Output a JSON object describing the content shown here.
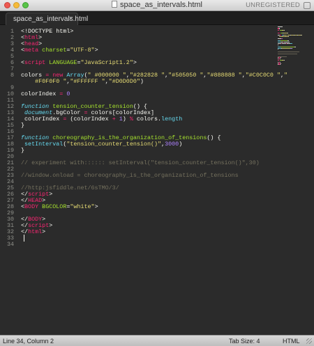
{
  "window": {
    "title": "space_as_intervals.html",
    "registration": "UNREGISTERED"
  },
  "tab": {
    "label": "space_as_intervals.html",
    "close_glyph": "×"
  },
  "theme": {
    "tag": "#f92672",
    "attr": "#a6e22e",
    "string": "#e6db74",
    "keyword": "#66d9ef",
    "number": "#ae81ff",
    "comment": "#75715e",
    "background": "#2b2b2b"
  },
  "code_lines": [
    {
      "n": "1",
      "tokens": [
        [
          "plain",
          "<!DOCTYPE html>"
        ]
      ]
    },
    {
      "n": "2",
      "tokens": [
        [
          "plain",
          "<"
        ],
        [
          "tag",
          "html"
        ],
        [
          "plain",
          ">"
        ]
      ]
    },
    {
      "n": "3",
      "tokens": [
        [
          "plain",
          "<"
        ],
        [
          "tag",
          "head"
        ],
        [
          "plain",
          ">"
        ]
      ]
    },
    {
      "n": "4",
      "tokens": [
        [
          "plain",
          "<"
        ],
        [
          "tag",
          "meta"
        ],
        [
          "plain",
          " "
        ],
        [
          "attr",
          "charset"
        ],
        [
          "plain",
          "="
        ],
        [
          "str",
          "\"UTF-8\""
        ],
        [
          "plain",
          ">"
        ]
      ]
    },
    {
      "n": "5",
      "tokens": []
    },
    {
      "n": "6",
      "tokens": [
        [
          "plain",
          "<"
        ],
        [
          "tag",
          "script"
        ],
        [
          "plain",
          " "
        ],
        [
          "attr",
          "LANGUAGE"
        ],
        [
          "plain",
          "="
        ],
        [
          "str",
          "\"JavaScript1.2\""
        ],
        [
          "plain",
          ">"
        ]
      ]
    },
    {
      "n": "7",
      "tokens": []
    },
    {
      "n": "8",
      "tokens": [
        [
          "plain",
          "colors "
        ],
        [
          "op",
          "="
        ],
        [
          "plain",
          " "
        ],
        [
          "op",
          "new"
        ],
        [
          "plain",
          " "
        ],
        [
          "prop",
          "Array"
        ],
        [
          "plain",
          "("
        ],
        [
          "str",
          "\" #000000 \""
        ],
        [
          "plain",
          ","
        ],
        [
          "str",
          "\"#282828 \""
        ],
        [
          "plain",
          ","
        ],
        [
          "str",
          "\"#505050 \""
        ],
        [
          "plain",
          ","
        ],
        [
          "str",
          "\"#888888 \""
        ],
        [
          "plain",
          ","
        ],
        [
          "str",
          "\"#C0C0C0 \""
        ],
        [
          "plain",
          ","
        ],
        [
          "str",
          "\""
        ]
      ]
    },
    {
      "n": "",
      "tokens": [
        [
          "plain",
          "    "
        ],
        [
          "str",
          "#F0F0F0 \""
        ],
        [
          "plain",
          ","
        ],
        [
          "str",
          "\"#FFFFFF \""
        ],
        [
          "plain",
          ","
        ],
        [
          "str",
          "\"#D0D0D0\""
        ],
        [
          "plain",
          ")"
        ]
      ]
    },
    {
      "n": "9",
      "tokens": []
    },
    {
      "n": "10",
      "tokens": [
        [
          "plain",
          "colorIndex "
        ],
        [
          "op",
          "="
        ],
        [
          "plain",
          " "
        ],
        [
          "num",
          "0"
        ]
      ]
    },
    {
      "n": "11",
      "tokens": []
    },
    {
      "n": "12",
      "tokens": [
        [
          "kw",
          "function"
        ],
        [
          "plain",
          " "
        ],
        [
          "fn",
          "tension_counter_tension"
        ],
        [
          "plain",
          "() {"
        ]
      ]
    },
    {
      "n": "13",
      "tokens": [
        [
          "plain",
          " "
        ],
        [
          "kw",
          "document"
        ],
        [
          "plain",
          ".bgColor "
        ],
        [
          "op",
          "="
        ],
        [
          "plain",
          " colors[colorIndex]"
        ]
      ]
    },
    {
      "n": "14",
      "tokens": [
        [
          "plain",
          " colorIndex "
        ],
        [
          "op",
          "="
        ],
        [
          "plain",
          " (colorIndex "
        ],
        [
          "op",
          "+"
        ],
        [
          "plain",
          " "
        ],
        [
          "num",
          "1"
        ],
        [
          "plain",
          ") "
        ],
        [
          "op",
          "%"
        ],
        [
          "plain",
          " colors."
        ],
        [
          "prop",
          "length"
        ]
      ]
    },
    {
      "n": "15",
      "tokens": [
        [
          "plain",
          "}"
        ]
      ]
    },
    {
      "n": "16",
      "tokens": []
    },
    {
      "n": "17",
      "tokens": [
        [
          "kw",
          "function"
        ],
        [
          "plain",
          " "
        ],
        [
          "fn",
          "choreography_is_the_organization_of_tensions"
        ],
        [
          "plain",
          "() {"
        ]
      ]
    },
    {
      "n": "18",
      "tokens": [
        [
          "plain",
          " "
        ],
        [
          "prop",
          "setInterval"
        ],
        [
          "plain",
          "("
        ],
        [
          "str",
          "\"tension_counter_tension()\""
        ],
        [
          "plain",
          ","
        ],
        [
          "num",
          "3000"
        ],
        [
          "plain",
          ")"
        ]
      ]
    },
    {
      "n": "19",
      "tokens": [
        [
          "plain",
          "}"
        ]
      ]
    },
    {
      "n": "20",
      "tokens": []
    },
    {
      "n": "21",
      "tokens": [
        [
          "cmt",
          "// experiment with:::::: setInterval(\"tension_counter_tension()\",30)"
        ]
      ]
    },
    {
      "n": "22",
      "tokens": []
    },
    {
      "n": "23",
      "tokens": [
        [
          "cmt",
          "//window.onload = choreography_is_the_organization_of_tensions"
        ]
      ]
    },
    {
      "n": "24",
      "tokens": []
    },
    {
      "n": "25",
      "tokens": [
        [
          "cmt",
          "//http:jsfiddle.net/6sTMO/3/"
        ]
      ]
    },
    {
      "n": "26",
      "tokens": [
        [
          "plain",
          "</"
        ],
        [
          "tag",
          "script"
        ],
        [
          "plain",
          ">"
        ]
      ]
    },
    {
      "n": "27",
      "tokens": [
        [
          "plain",
          "</"
        ],
        [
          "tag",
          "HEAD"
        ],
        [
          "plain",
          ">"
        ]
      ]
    },
    {
      "n": "28",
      "tokens": [
        [
          "plain",
          "<"
        ],
        [
          "tag",
          "BODY"
        ],
        [
          "plain",
          " "
        ],
        [
          "attr",
          "BGCOLOR"
        ],
        [
          "plain",
          "="
        ],
        [
          "str",
          "\"white\""
        ],
        [
          "plain",
          ">"
        ]
      ]
    },
    {
      "n": "29",
      "tokens": []
    },
    {
      "n": "30",
      "tokens": [
        [
          "plain",
          "</"
        ],
        [
          "tag",
          "BODY"
        ],
        [
          "plain",
          ">"
        ]
      ]
    },
    {
      "n": "31",
      "tokens": [
        [
          "plain",
          "</"
        ],
        [
          "tag",
          "script"
        ],
        [
          "plain",
          ">"
        ]
      ]
    },
    {
      "n": "32",
      "tokens": [
        [
          "plain",
          "</"
        ],
        [
          "tag",
          "html"
        ],
        [
          "plain",
          ">"
        ]
      ]
    },
    {
      "n": "33",
      "tokens": []
    },
    {
      "n": "34",
      "tokens": []
    }
  ],
  "status": {
    "position": "Line 34, Column 2",
    "tab_size": "Tab Size: 4",
    "syntax": "HTML"
  }
}
